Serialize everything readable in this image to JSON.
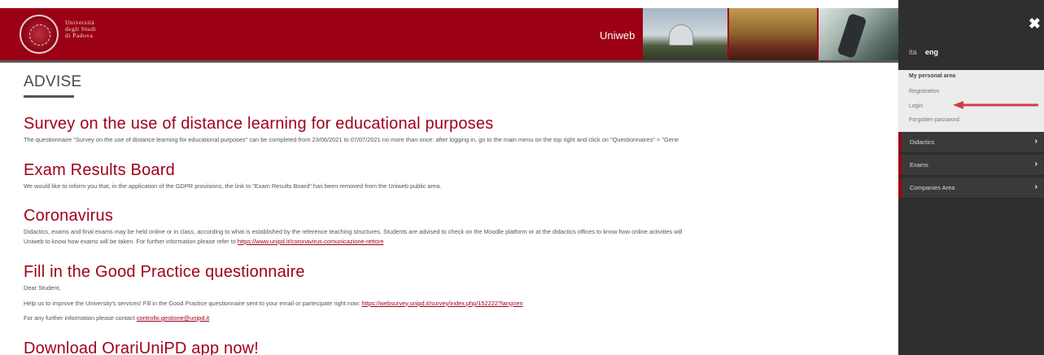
{
  "header": {
    "logo_lines": [
      "Università",
      "degli Studi",
      "di Padova"
    ],
    "app_name": "Uniweb"
  },
  "page_title": "ADVISE",
  "news": [
    {
      "title": "Survey on the use of distance learning for educational purposes",
      "text": "The questionnaire \"Survey on the use of distance learning for educational purposes\" can be completed from 23/06/2021 to 07/07/2021 no more than once: after logging in, go to the main menu on the top right and click on \"Questionnaires\" > \"Gene"
    },
    {
      "title": "Exam Results Board",
      "text": "We would like to inform you that, in the application of the GDPR provisions, the link to \"Exam Results Board\" has been removed from the Uniweb public area."
    },
    {
      "title": "Coronavirus",
      "text": "Didactics, exams and final exams may be held online or in class, according to what is established by the reference teaching structures. Students are advised to check on the Moodle platform or at the didactics offices to know how online activities will",
      "text2": "Uniweb to know how exams will be taken. For further information please refer to",
      "link": "https://www.unipd.it/coronavirus-comunicazione-rettore"
    },
    {
      "title": "Fill in the Good Practice questionnaire",
      "greeting": "Dear Student,",
      "text": "Help us to improve the University's services! Fill in the Good Practice questionnaire sent to your email or partecipate right now:",
      "link": "https://websurvey.unipd.it/survey/index.php/152222?lang=en",
      "contact_text": "For any further information please contact",
      "contact_link": "controllo.gestione@unipd.it"
    },
    {
      "title": "Download OrariUniPD app now!"
    }
  ],
  "panel": {
    "close_label": "✖",
    "lang_ita": "ita",
    "lang_eng": "eng",
    "personal_title": "My personal area",
    "links": [
      "Registration",
      "Login",
      "Forgotten password"
    ],
    "menu": [
      "Didactics",
      "Exams",
      "Companies Area"
    ],
    "chevron": "›"
  },
  "colors": {
    "brand": "#9b0014",
    "panel_bg": "#2f2f2f",
    "annotation_arrow": "#d0404a"
  }
}
